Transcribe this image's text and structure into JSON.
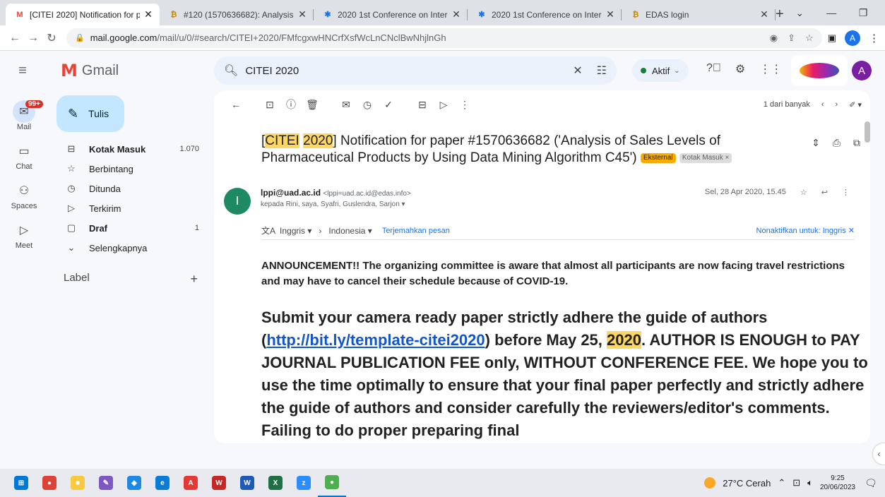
{
  "browser": {
    "tabs": [
      {
        "title": "[CITEI 2020] Notification for p",
        "favicon": "gmail-icon",
        "active": true
      },
      {
        "title": "#120 (1570636682): Analysis",
        "favicon": "edas-icon",
        "active": false
      },
      {
        "title": "2020 1st Conference on Inter",
        "favicon": "conference-icon",
        "active": false
      },
      {
        "title": "2020 1st Conference on Inter",
        "favicon": "conference-icon",
        "active": false
      },
      {
        "title": "EDAS login",
        "favicon": "edas-icon",
        "active": false
      }
    ],
    "tab_close": "✕",
    "new_tab": "+",
    "url_host": "mail.google.com",
    "url_path": "/mail/u/0/#search/CITEI+2020/FMfcgxwHNCrfXsfWcLnCNclBwNhjlnGh",
    "profile_initial": "A"
  },
  "gmail": {
    "app_name": "Gmail",
    "search_query": "CITEI 2020",
    "status": "Aktif",
    "account_initial": "A",
    "rail": [
      {
        "label": "Mail",
        "icon": "mail-icon",
        "badge": "99+"
      },
      {
        "label": "Chat",
        "icon": "chat-icon"
      },
      {
        "label": "Spaces",
        "icon": "spaces-icon"
      },
      {
        "label": "Meet",
        "icon": "meet-icon"
      }
    ],
    "compose_label": "Tulis",
    "nav": [
      {
        "label": "Kotak Masuk",
        "count": "1.070",
        "icon": "inbox-icon",
        "bold": true
      },
      {
        "label": "Berbintang",
        "count": "",
        "icon": "star-icon",
        "bold": false
      },
      {
        "label": "Ditunda",
        "count": "",
        "icon": "clock-icon",
        "bold": false
      },
      {
        "label": "Terkirim",
        "count": "",
        "icon": "send-icon",
        "bold": false
      },
      {
        "label": "Draf",
        "count": "1",
        "icon": "draft-icon",
        "bold": true
      },
      {
        "label": "Selengkapnya",
        "count": "",
        "icon": "chevron-down-icon",
        "bold": false
      }
    ],
    "labels_header": "Label",
    "labels_add": "+"
  },
  "message": {
    "pager_text": "1 dari banyak",
    "subject_hl1": "CITEI",
    "subject_hl2": "2020",
    "subject_rest": "] Notification for paper #1570636682 ('Analysis of Sales Levels of Pharmaceutical Products by Using Data Mining Algorithm C45')",
    "tag_external": "Eksternal",
    "tag_inbox": "Kotak Masuk",
    "sender_initial": "l",
    "sender_name": "lppi@uad.ac.id",
    "sender_email": "<lppi=uad.ac.id@edas.info>",
    "recipients": "kepada Rini, saya, Syafri, Guslendra, Sarjon",
    "date": "Sel, 28 Apr 2020, 15.45",
    "translate_from": "Inggris",
    "translate_to": "Indonesia",
    "translate_link": "Terjemahkan pesan",
    "translate_off": "Nonaktifkan untuk: Inggris",
    "announcement": "ANNOUNCEMENT!! The organizing committee is aware that almost all participants are now facing travel restrictions and may have to cancel their schedule because of COVID-19.",
    "body_part1": "Submit your camera ready paper strictly adhere the guide of authors (",
    "body_link": "http://bit.ly/template-citei2020",
    "body_part2": ") before May 25, ",
    "body_hl": "2020",
    "body_part3": ". AUTHOR IS ENOUGH to PAY JOURNAL PUBLICATION FEE only, WITHOUT CONFERENCE FEE. We hope you to use the time optimally to ensure that your final paper perfectly and strictly adhere the guide of authors and consider carefully the reviewers/editor's comments. Failing to do proper preparing final"
  },
  "taskbar": {
    "weather": "27°C  Cerah",
    "time": "9:25",
    "date": "20/06/2023",
    "apps": [
      {
        "name": "start",
        "color": "#0078d4",
        "glyph": "⊞"
      },
      {
        "name": "chrome",
        "color": "#db4437",
        "glyph": "●"
      },
      {
        "name": "file-explorer",
        "color": "#f9c940",
        "glyph": "■"
      },
      {
        "name": "paint",
        "color": "#7e57c2",
        "glyph": "✎"
      },
      {
        "name": "app-blue",
        "color": "#1e88e5",
        "glyph": "◆"
      },
      {
        "name": "edge",
        "color": "#0a7cd6",
        "glyph": "e"
      },
      {
        "name": "acrobat",
        "color": "#e53935",
        "glyph": "A"
      },
      {
        "name": "wps",
        "color": "#c62828",
        "glyph": "W"
      },
      {
        "name": "word",
        "color": "#1e5bb8",
        "glyph": "W"
      },
      {
        "name": "excel",
        "color": "#1e7145",
        "glyph": "X"
      },
      {
        "name": "zoom",
        "color": "#2d8cff",
        "glyph": "z"
      },
      {
        "name": "chrome-profile",
        "color": "#4caf50",
        "glyph": "●"
      }
    ]
  }
}
